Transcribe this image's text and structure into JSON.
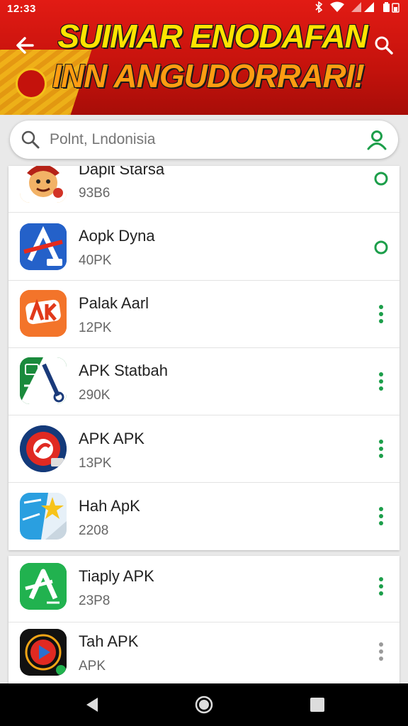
{
  "status_bar": {
    "time": "12:33"
  },
  "header": {
    "banner_line1": "SUIMAR ENODAFAN",
    "banner_line2": "INN ANGUDORRARI!"
  },
  "search": {
    "placeholder": "Polnt, Lndonisia"
  },
  "apps": [
    {
      "name": "Daplt Starsa",
      "size": "93B6",
      "action": "circle",
      "icon": "face-icon"
    },
    {
      "name": "Aopk Dyna",
      "size": "40PK",
      "action": "circle",
      "icon": "blue-a-icon"
    },
    {
      "name": "Palak Aarl",
      "size": "12PK",
      "action": "dots",
      "icon": "orange-ak-icon"
    },
    {
      "name": "APK Statbah",
      "size": "290K",
      "action": "dots",
      "icon": "green-wrench-icon"
    },
    {
      "name": "APK APK",
      "size": "13PK",
      "action": "dots",
      "icon": "red-seal-icon"
    },
    {
      "name": "Hah ApK",
      "size": "2208",
      "action": "dots",
      "icon": "star-map-icon"
    },
    {
      "name": "Tiaply APK",
      "size": "23P8",
      "action": "dots",
      "icon": "green-a-icon"
    },
    {
      "name": "Tah APK",
      "size": "APK",
      "action": "dots-grey",
      "icon": "play-icon"
    }
  ],
  "colors": {
    "header_red": "#e21b14",
    "accent_green": "#1c9e4a",
    "banner_yellow": "#ffe400",
    "banner_orange": "#ff9c12"
  }
}
